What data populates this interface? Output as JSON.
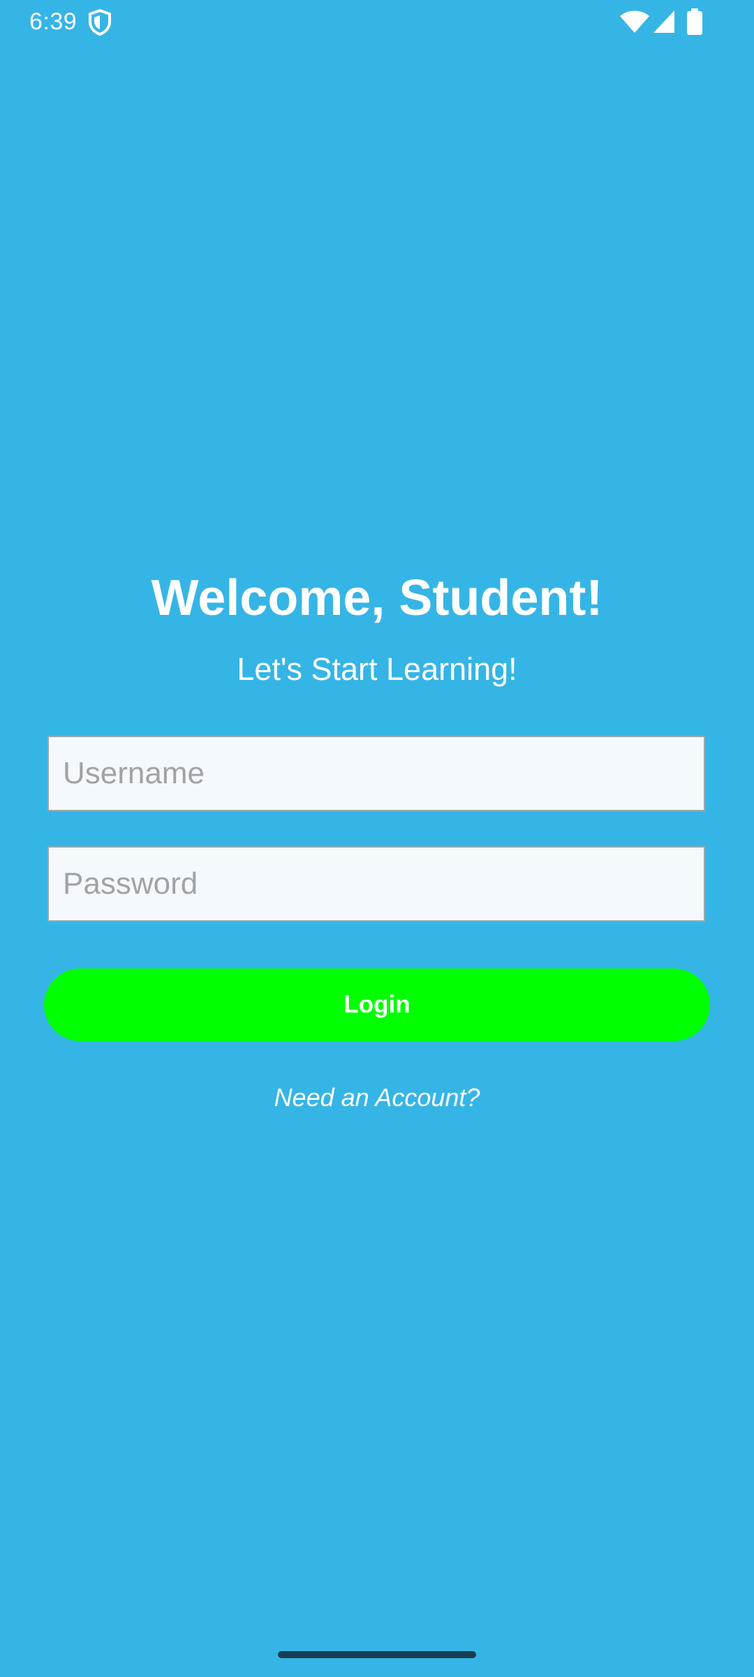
{
  "status_bar": {
    "time": "6:39",
    "icons": [
      "shield-icon",
      "wifi-icon",
      "signal-icon",
      "battery-icon"
    ]
  },
  "login": {
    "title": "Welcome, Student!",
    "subtitle": "Let's Start Learning!",
    "username_placeholder": "Username",
    "username_value": "",
    "password_placeholder": "Password",
    "password_value": "",
    "login_label": "Login",
    "need_account_label": "Need an Account?"
  },
  "colors": {
    "background": "#35b5e6",
    "login_button": "#00ff00",
    "input_background": "#f4f9fd",
    "text": "#ffffff"
  }
}
